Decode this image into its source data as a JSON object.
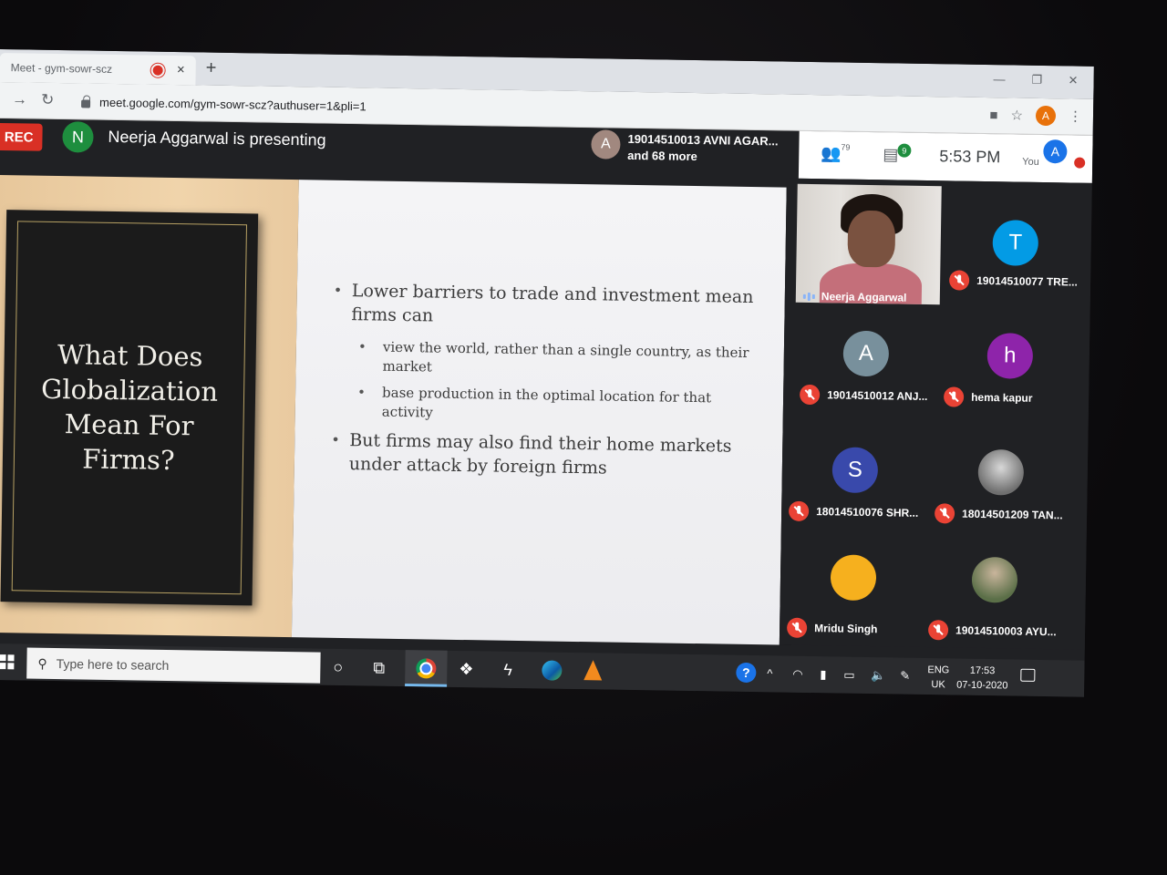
{
  "browser": {
    "tab_title": "Meet - gym-sowr-scz",
    "tab_close": "×",
    "new_tab": "+",
    "url": "meet.google.com/gym-sowr-scz?authuser=1&pli=1",
    "profile_initial": "A"
  },
  "meet": {
    "rec_label": "REC",
    "presenter_initial": "N",
    "presenting_text": "Neerja Aggarwal is presenting",
    "joiner_initial": "A",
    "joiner_line1": "19014510013 AVNI AGAR...",
    "joiner_line2": "and 68 more",
    "people_count": "79",
    "chat_count": "9",
    "time": "5:53 PM",
    "you_label": "You",
    "you_initial": "A"
  },
  "slide": {
    "title_lines": [
      "What Does",
      "Globalization",
      "Mean For",
      "Firms?"
    ],
    "bullet1": "Lower barriers to trade and investment mean firms can",
    "sub1": "view the world, rather than a single country, as their market",
    "sub2": "base production in the optimal location for that activity",
    "bullet2": "But firms may also find their home markets under attack by foreign firms"
  },
  "participants": [
    {
      "name": "Neerja Aggarwal",
      "initial": "",
      "color": "",
      "video": true
    },
    {
      "name": "19014510077 TRE...",
      "initial": "T",
      "color": "#039be5"
    },
    {
      "name": "19014510012 ANJ...",
      "initial": "A",
      "color": "#78909c"
    },
    {
      "name": "hema kapur",
      "initial": "h",
      "color": "#8e24aa"
    },
    {
      "name": "18014510076 SHR...",
      "initial": "S",
      "color": "#3949ab"
    },
    {
      "name": "18014501209 TAN...",
      "initial": "",
      "color": "photo"
    },
    {
      "name": "Mridu Singh",
      "initial": "",
      "color": "#f6b01e"
    },
    {
      "name": "19014510003 AYU...",
      "initial": "",
      "color": "photo2"
    }
  ],
  "taskbar": {
    "search_placeholder": "Type here to search",
    "lang_line1": "ENG",
    "lang_line2": "UK",
    "time": "17:53",
    "date": "07-10-2020"
  }
}
